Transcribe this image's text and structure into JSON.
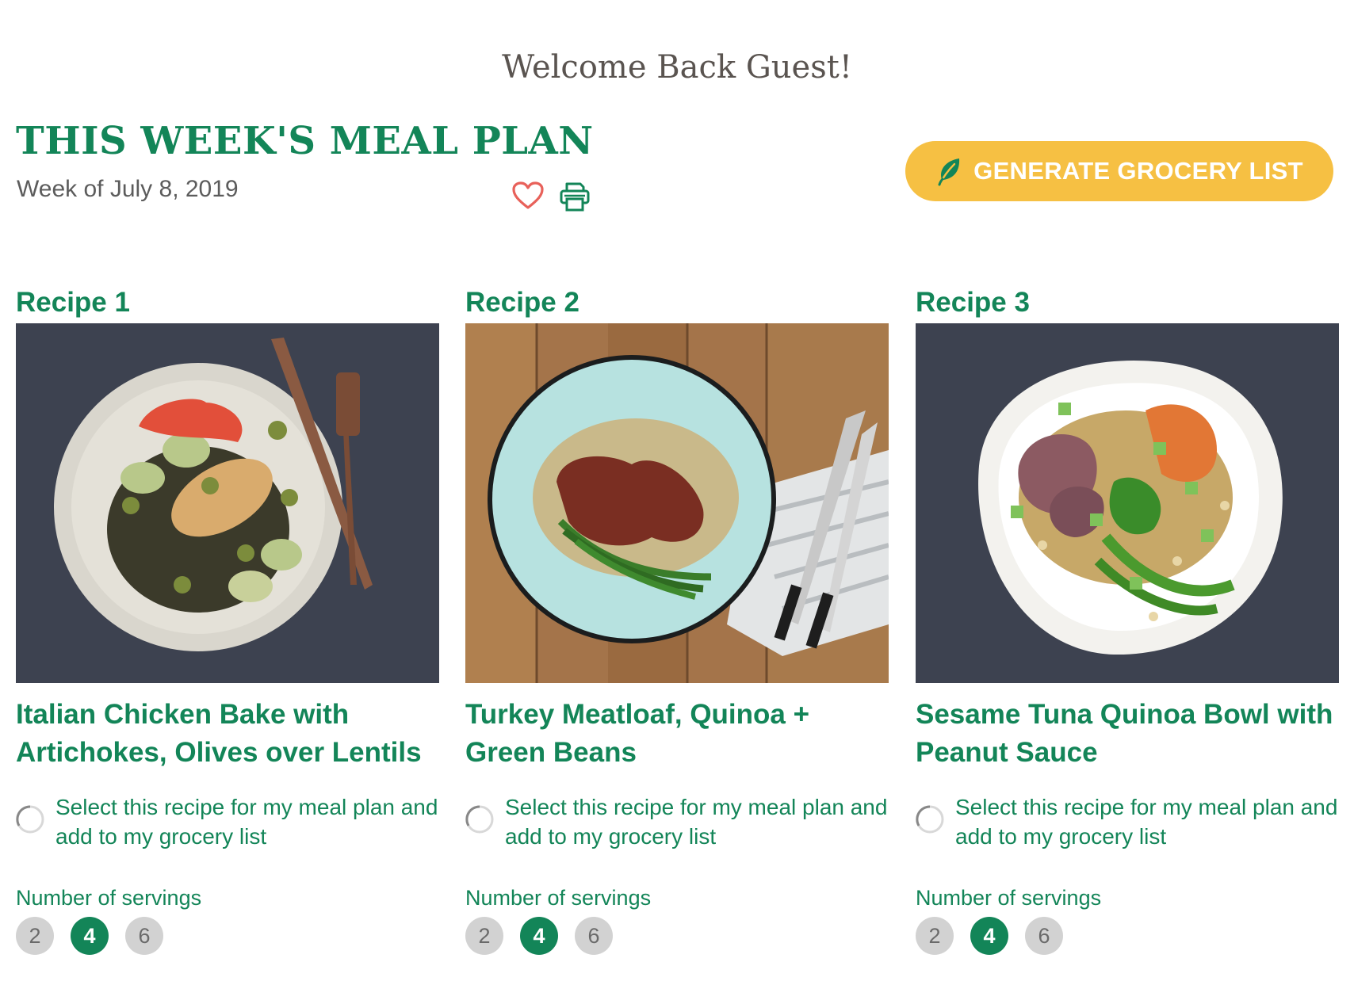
{
  "header": {
    "welcome": "Welcome Back Guest!",
    "plan_title": "THIS WEEK'S MEAL PLAN",
    "week_of": "Week of July 8, 2019",
    "grocery_button": "GENERATE GROCERY LIST"
  },
  "colors": {
    "brand_green": "#138558",
    "button_yellow": "#f6c043",
    "heart_red": "#e8615a"
  },
  "icons": [
    "heart-icon",
    "printer-icon",
    "leaf-icon",
    "radio-icon"
  ],
  "recipes": [
    {
      "label": "Recipe 1",
      "title": "Italian Chicken Bake with Artichokes, Olives over Lentils",
      "select_text": "Select this recipe for my meal plan and add to my grocery list",
      "servings_label": "Number of servings",
      "servings": [
        "2",
        "4",
        "6"
      ],
      "selected_serving": "4"
    },
    {
      "label": "Recipe 2",
      "title": "Turkey Meatloaf, Quinoa + Green Beans",
      "select_text": "Select this recipe for my meal plan and add to my grocery list",
      "servings_label": "Number of servings",
      "servings": [
        "2",
        "4",
        "6"
      ],
      "selected_serving": "4"
    },
    {
      "label": "Recipe 3",
      "title": "Sesame Tuna Quinoa Bowl with Peanut Sauce",
      "select_text": "Select this recipe for my meal plan and add to my grocery list",
      "servings_label": "Number of servings",
      "servings": [
        "2",
        "4",
        "6"
      ],
      "selected_serving": "4"
    }
  ]
}
